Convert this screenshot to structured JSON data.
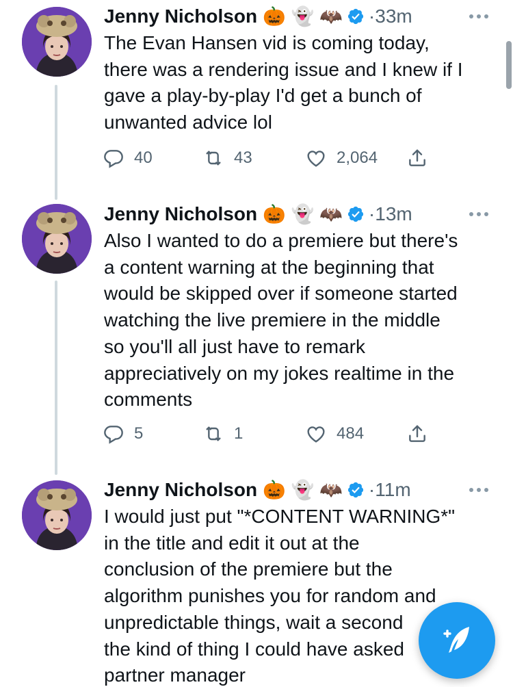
{
  "author": {
    "name": "Jenny Nicholson",
    "emojis": [
      "🎃",
      "👻",
      "🦇"
    ]
  },
  "tweets": [
    {
      "time": "33m",
      "text": "The Evan Hansen vid is coming today,\nthere was a rendering issue and I knew if I\ngave a play-by-play I'd get a bunch of\nunwanted advice lol",
      "replies": "40",
      "retweets": "43",
      "likes": "2,064"
    },
    {
      "time": "13m",
      "text": "Also I wanted to do a premiere but there's\na content warning at the beginning that\nwould be skipped over if someone started\nwatching the live premiere in the middle\nso you'll all just have to remark\nappreciatively on my jokes realtime in the\ncomments",
      "replies": "5",
      "retweets": "1",
      "likes": "484"
    },
    {
      "time": "11m",
      "text": "I would just put \"*CONTENT WARNING*\"\nin the title and edit it out at the\nconclusion of the premiere but the\nalgorithm punishes you for random and\nunpredictable things, wait a second\nthe kind of thing I could have asked\npartner manager"
    }
  ],
  "separator": "·",
  "icons": {
    "verified": "verified-badge-icon",
    "more": "more-icon",
    "reply": "reply-icon",
    "retweet": "retweet-icon",
    "like": "heart-icon",
    "share": "share-icon",
    "compose": "compose-tweet-icon"
  },
  "colors": {
    "accent": "#1d9bf0",
    "text": "#0f1419",
    "muted": "#536471",
    "thread_line": "#cfd9de"
  }
}
